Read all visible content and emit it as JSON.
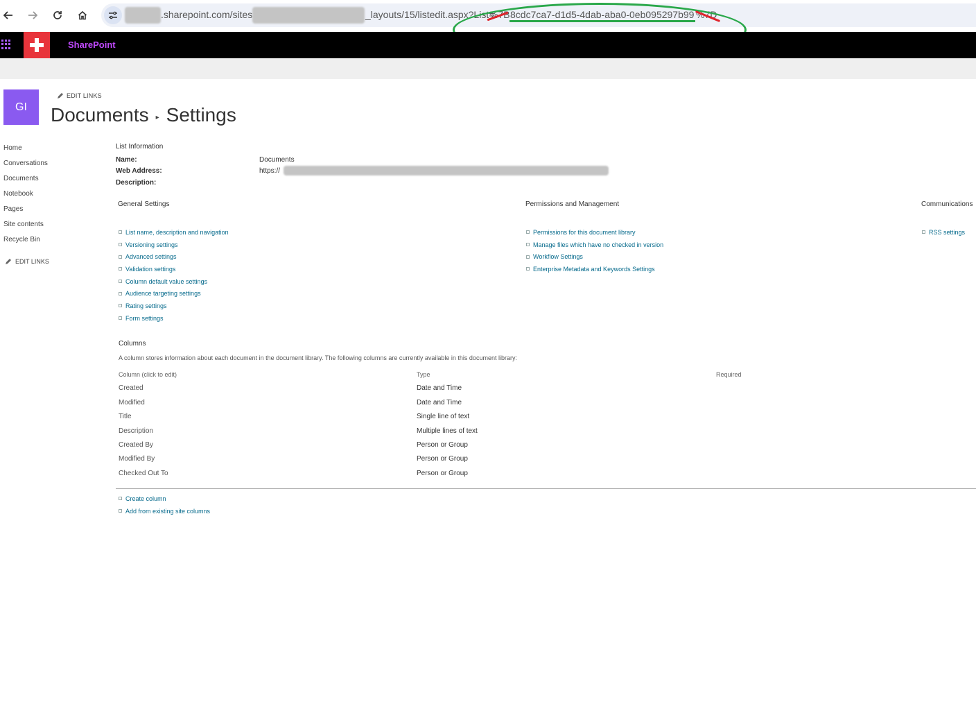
{
  "browser": {
    "url_domain": ".sharepoint.com/sites",
    "url_path": "_layouts/15/listedit.aspx?List=",
    "url_prefix": "%7B",
    "url_guid": "8cdc7ca7-d1d5-4dab-aba0-0eb095297b99",
    "url_suffix": "%7D"
  },
  "suite": {
    "app_name": "SharePoint"
  },
  "site": {
    "logo_text": "GI",
    "edit_links": "EDIT LINKS",
    "breadcrumb": [
      "Documents",
      "Settings"
    ],
    "breadcrumb_sep": "▸"
  },
  "leftnav": {
    "items": [
      "Home",
      "Conversations",
      "Documents",
      "Notebook",
      "Pages",
      "Site contents",
      "Recycle Bin"
    ],
    "edit_links": "EDIT LINKS"
  },
  "list_info": {
    "heading": "List Information",
    "name_label": "Name:",
    "name_value": "Documents",
    "web_label": "Web Address:",
    "web_value": "https://",
    "desc_label": "Description:"
  },
  "general": {
    "heading": "General Settings",
    "links": [
      "List name, description and navigation",
      "Versioning settings",
      "Advanced settings",
      "Validation settings",
      "Column default value settings",
      "Audience targeting settings",
      "Rating settings",
      "Form settings"
    ]
  },
  "permissions": {
    "heading": "Permissions and Management",
    "links": [
      "Permissions for this document library",
      "Manage files which have no checked in version",
      "Workflow Settings",
      "Enterprise Metadata and Keywords Settings"
    ]
  },
  "communications": {
    "heading": "Communications",
    "links": [
      "RSS settings"
    ]
  },
  "columns": {
    "heading": "Columns",
    "description": "A column stores information about each document in the document library. The following columns are currently available in this document library:",
    "headers": [
      "Column (click to edit)",
      "Type",
      "Required"
    ],
    "rows": [
      {
        "name": "Created",
        "type": "Date and Time"
      },
      {
        "name": "Modified",
        "type": "Date and Time"
      },
      {
        "name": "Title",
        "type": "Single line of text"
      },
      {
        "name": "Description",
        "type": "Multiple lines of text"
      },
      {
        "name": "Created By",
        "type": "Person or Group"
      },
      {
        "name": "Modified By",
        "type": "Person or Group"
      },
      {
        "name": "Checked Out To",
        "type": "Person or Group"
      }
    ],
    "actions": [
      "Create column",
      "Add from existing site columns"
    ]
  },
  "colors": {
    "link": "#066a8c",
    "suite_bg": "#000000",
    "brand_text": "#c24aff",
    "site_logo_bg": "#8a5af0",
    "annotation_green": "#2aa84a",
    "annotation_red": "#e0242c"
  }
}
